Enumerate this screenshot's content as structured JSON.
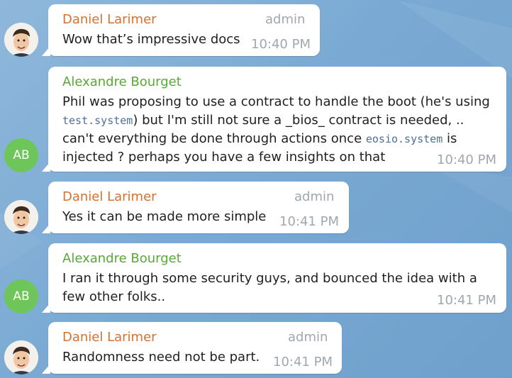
{
  "theme": {
    "accent_orange": "#d6702d",
    "accent_green": "#56a936",
    "avatar_green": "#6ec55a",
    "background": "#7aaad3"
  },
  "messages": [
    {
      "sender": "Daniel Larimer",
      "role": "admin",
      "text": "Wow that’s impressive docs",
      "time": "10:40 PM",
      "avatar": "caricature-avatar"
    },
    {
      "sender": "Alexandre Bourget",
      "initials": "AB",
      "line1": "Phil was proposing to use a contract to handle the boot (he's using",
      "line2_code": "test.system",
      "line2_rest": ") but I'm still not sure a _bios_ contract is needed, ..",
      "line3_pre": "can't everything be done through actions once ",
      "line3_code": "eosio.system",
      "line3_post": " is",
      "line4": "injected ? perhaps you have a few insights on that",
      "time": "10:40 PM"
    },
    {
      "sender": "Daniel Larimer",
      "role": "admin",
      "text": "Yes it can be made more simple",
      "time": "10:41 PM",
      "avatar": "caricature-avatar"
    },
    {
      "sender": "Alexandre Bourget",
      "initials": "AB",
      "line1": "I ran it through some security guys, and bounced the idea with a",
      "line2": "few other folks..",
      "time": "10:41 PM"
    },
    {
      "sender": "Daniel Larimer",
      "role": "admin",
      "text": "Randomness need not be part.",
      "time": "10:41 PM",
      "avatar": "caricature-avatar"
    }
  ]
}
